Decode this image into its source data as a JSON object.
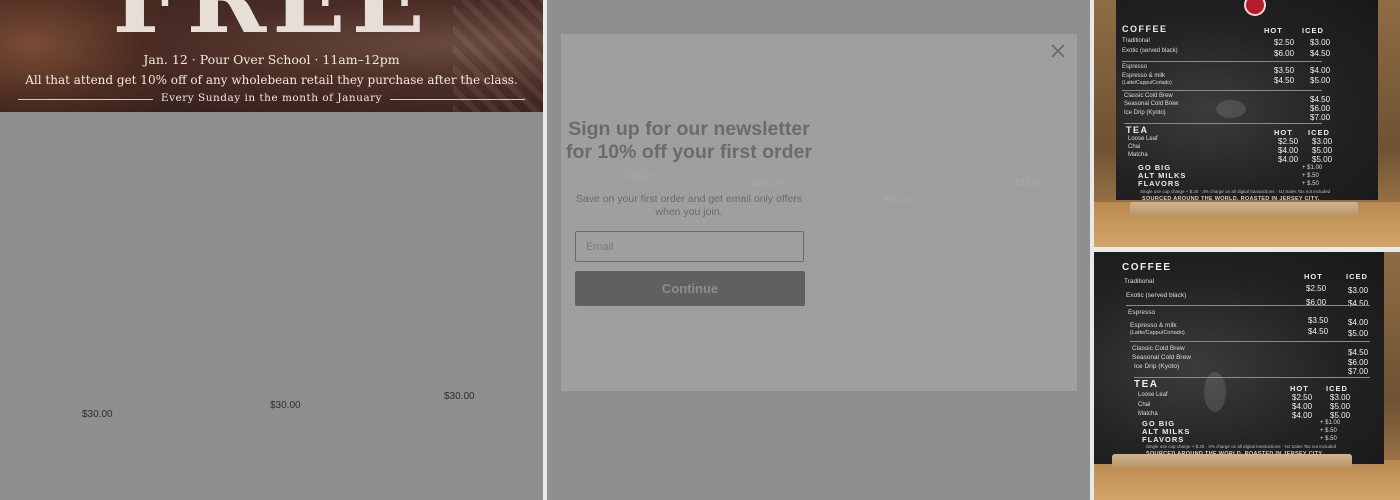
{
  "banner": {
    "headline": "FREE",
    "event_line": "Jan. 12 · Pour Over School · 11am–12pm",
    "offer_line": "All that attend get 10% off of any wholebean retail they purchase after the class.",
    "recurrence": "Every Sunday in the month of January"
  },
  "left_prices": [
    "$30.00",
    "$30.00",
    "$30.00"
  ],
  "background_prices": [
    "$30.00",
    "$22.00",
    "$30.00",
    "$25.00"
  ],
  "newsletter": {
    "title": "Sign up for our newsletter for 10% off your first order",
    "subtitle": "Save on your first order and get email only offers when you join.",
    "email_placeholder": "Email",
    "continue_label": "Continue",
    "close_icon": "close-icon"
  },
  "menu": {
    "coffee_heading": "COFFEE",
    "hot": "HOT",
    "iced": "ICED",
    "coffee_items": [
      {
        "name": "Traditional",
        "hot": "$2.50",
        "iced": "$3.00"
      },
      {
        "name": "Exotic (served black)",
        "hot": "$6.00",
        "iced": "$4.50"
      },
      {
        "name": "Espresso",
        "hot": "$3.50",
        "iced": "$4.00"
      },
      {
        "name": "Espresso & milk",
        "sub": "(Latte/Cappu/Cortado)",
        "hot": "$4.50",
        "iced": "$5.00"
      },
      {
        "name": "Classic Cold Brew",
        "hot": "",
        "iced": "$4.50"
      },
      {
        "name": "Seasonal Cold Brew",
        "hot": "",
        "iced": "$6.00"
      },
      {
        "name": "Ice Drip (Kyoto)",
        "hot": "",
        "iced": "$7.00"
      }
    ],
    "tea_heading": "TEA",
    "tea_items": [
      {
        "name": "Loose Leaf",
        "hot": "$2.50",
        "iced": "$3.00"
      },
      {
        "name": "Chai",
        "hot": "$4.00",
        "iced": "$5.00"
      },
      {
        "name": "Matcha",
        "hot": "$4.00",
        "iced": "$5.00"
      }
    ],
    "extras": [
      {
        "label": "GO BIG",
        "price": "+ $1.00"
      },
      {
        "label": "ALT MILKS",
        "price": "+ $.50"
      },
      {
        "label": "FLAVORS",
        "price": "+ $.50"
      }
    ],
    "footnote": "Single use cup charge + $.25 · 3% charge on all digital transactions · NJ Sales Tax not included",
    "sourced": "SOURCED AROUND THE WORLD. ROASTED IN JERSEY CITY."
  }
}
